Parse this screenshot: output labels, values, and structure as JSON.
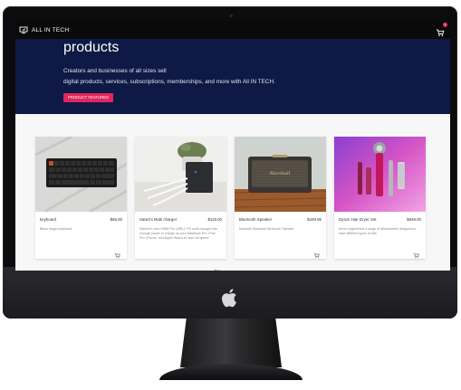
{
  "app": {
    "brand": "ALL IN TECH",
    "cart_count": "1"
  },
  "hero": {
    "title": "products",
    "subtitle_line1": "Creators and businesses of all sizes sell",
    "subtitle_line2": "digital products, services, subscriptions, memberships, and more with All IN TECH.",
    "button_label": "PRODUCT FEATURES"
  },
  "products": [
    {
      "name": "keyboard",
      "price": "$65.00",
      "description": "Black magic keyboard"
    },
    {
      "name": "Satechi Multi charger",
      "price": "$119.00",
      "description": "Satechi's new 108W Pro USB-C PD multi-charger has enough power to charge up your MacBook Pro, iPad Pro, iPhone, and Apple Watch at near full speed"
    },
    {
      "name": "Bluetooth Speaker",
      "price": "$438.95",
      "description": "Marshall Stanmore Bluetooth Speaker"
    },
    {
      "name": "Dyson Hair Dryer Set",
      "price": "$649.00",
      "description": "we've engineered a range of attachments designed to style different types of hair."
    }
  ],
  "icons": {
    "brand": "storefront-icon",
    "cart": "shopping-cart-icon",
    "add_to_cart": "add-shopping-cart-icon",
    "apple": "apple-logo"
  },
  "colors": {
    "hero_bg": "#0e1a45",
    "accent": "#e3255f",
    "topbar_bg": "#0a0a0a"
  }
}
